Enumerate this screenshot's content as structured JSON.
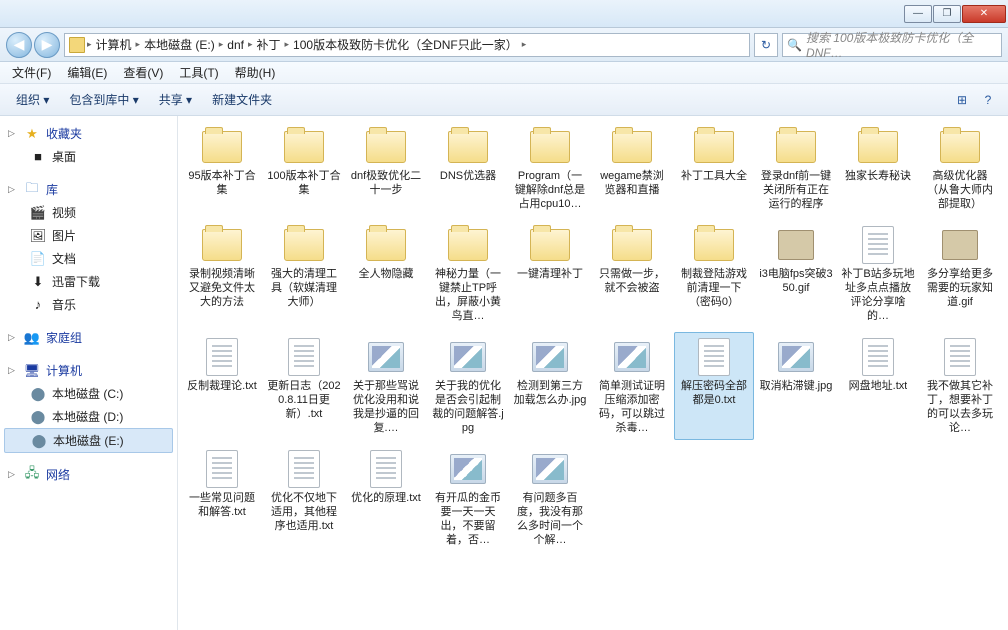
{
  "window": {
    "minimize": "—",
    "maximize": "❐",
    "close": "✕"
  },
  "nav": {
    "back": "◀",
    "fwd": "▶",
    "refresh": "↻"
  },
  "breadcrumb": [
    "计算机",
    "本地磁盘 (E:)",
    "dnf",
    "补丁",
    "100版本极致防卡优化（全DNF只此一家）"
  ],
  "search": {
    "placeholder": "搜索 100版本极致防卡优化（全DNF…",
    "icon": "🔍"
  },
  "menu": {
    "file": "文件(F)",
    "edit": "编辑(E)",
    "view": "查看(V)",
    "tools": "工具(T)",
    "help": "帮助(H)"
  },
  "toolbar": {
    "organize": "组织 ▾",
    "include": "包含到库中 ▾",
    "share": "共享 ▾",
    "newfolder": "新建文件夹",
    "view_ico": "⊞",
    "help_ico": "?"
  },
  "sidebar": {
    "favorites": {
      "head": "收藏夹",
      "items": [
        "桌面"
      ]
    },
    "libraries": {
      "head": "库",
      "items": [
        "视频",
        "图片",
        "文档",
        "迅雷下载",
        "音乐"
      ]
    },
    "homegroup": {
      "head": "家庭组"
    },
    "computer": {
      "head": "计算机",
      "items": [
        "本地磁盘 (C:)",
        "本地磁盘 (D:)",
        "本地磁盘 (E:)"
      ]
    },
    "network": {
      "head": "网络"
    }
  },
  "files": [
    {
      "name": "95版本补丁合集",
      "type": "folder"
    },
    {
      "name": "100版本补丁合集",
      "type": "folder"
    },
    {
      "name": "dnf极致优化二十一步",
      "type": "folder"
    },
    {
      "name": "DNS优选器",
      "type": "folder"
    },
    {
      "name": "Program（一键解除dnf总是占用cpu10…",
      "type": "folder"
    },
    {
      "name": "wegame禁浏览器和直播",
      "type": "folder"
    },
    {
      "name": "补丁工具大全",
      "type": "folder"
    },
    {
      "name": "登录dnf前一键关闭所有正在运行的程序",
      "type": "folder"
    },
    {
      "name": "独家长寿秘诀",
      "type": "folder"
    },
    {
      "name": "高级优化器（从鲁大师内部提取）",
      "type": "folder"
    },
    {
      "name": "录制视频清晰又避免文件太大的方法",
      "type": "folder"
    },
    {
      "name": "强大的清理工具（软媒清理大师）",
      "type": "folder"
    },
    {
      "name": "全人物隐藏",
      "type": "folder"
    },
    {
      "name": "神秘力量（一键禁止TP呼出，屏蔽小黄鸟直…",
      "type": "folder"
    },
    {
      "name": "一键清理补丁",
      "type": "folder"
    },
    {
      "name": "只需做一步，就不会被盗",
      "type": "folder"
    },
    {
      "name": "制裁登陆游戏前清理一下（密码0）",
      "type": "folder"
    },
    {
      "name": "i3电脑fps突破350.gif",
      "type": "gif"
    },
    {
      "name": "补丁B站多玩地址多点点播放评论分享啥的…",
      "type": "txt"
    },
    {
      "name": "多分享给更多需要的玩家知道.gif",
      "type": "gif"
    },
    {
      "name": "反制裁理论.txt",
      "type": "txt"
    },
    {
      "name": "更新日志（2020.8.11日更新）.txt",
      "type": "txt"
    },
    {
      "name": "关于那些骂说优化没用和说我是抄逼的回复.…",
      "type": "img"
    },
    {
      "name": "关于我的优化是否会引起制裁的问题解答.jpg",
      "type": "img"
    },
    {
      "name": "检测到第三方加载怎么办.jpg",
      "type": "img"
    },
    {
      "name": "简单测试证明压缩添加密码，可以跳过杀毒…",
      "type": "img"
    },
    {
      "name": "解压密码全部都是0.txt",
      "type": "txt",
      "selected": true
    },
    {
      "name": "取消粘滞键.jpg",
      "type": "img"
    },
    {
      "name": "网盘地址.txt",
      "type": "txt"
    },
    {
      "name": "我不做其它补丁，想要补丁的可以去多玩论…",
      "type": "txt"
    },
    {
      "name": "一些常见问题和解答.txt",
      "type": "txt"
    },
    {
      "name": "优化不仅地下适用，其他程序也适用.txt",
      "type": "txt"
    },
    {
      "name": "优化的原理.txt",
      "type": "txt"
    },
    {
      "name": "有开瓜的金币要一天一天出，不要留着，否…",
      "type": "img"
    },
    {
      "name": "有问题多百度，我没有那么多时间一个个解…",
      "type": "img"
    }
  ]
}
